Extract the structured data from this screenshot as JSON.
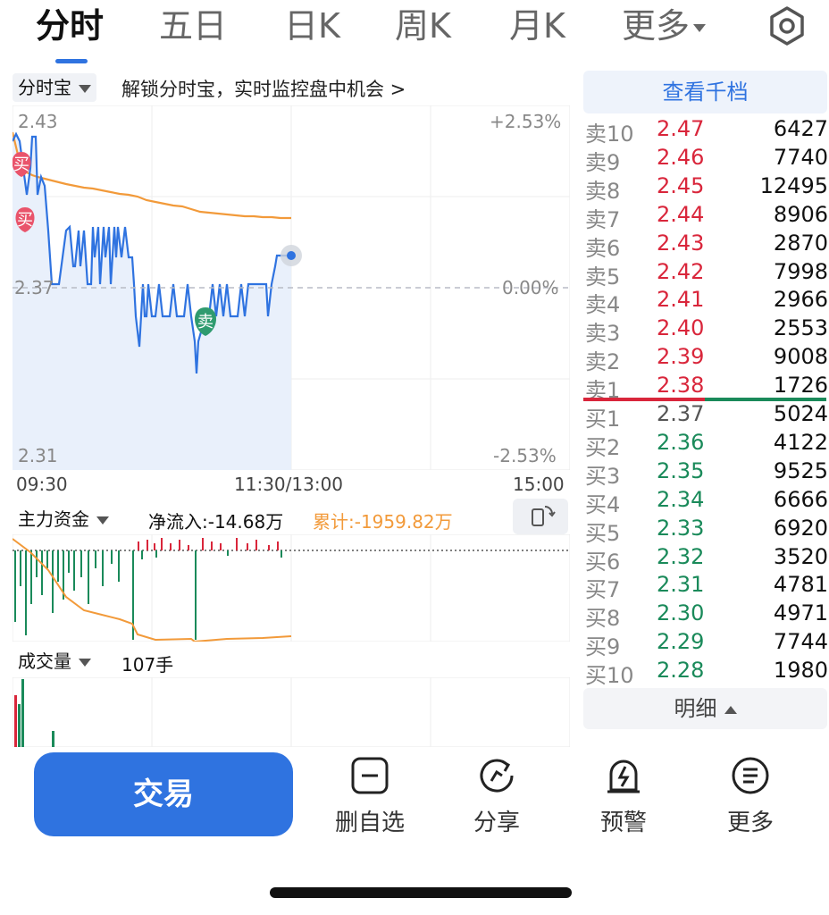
{
  "tabs": [
    "分时",
    "五日",
    "日K",
    "周K",
    "月K",
    "更多"
  ],
  "active_tab": "分时",
  "chart": {
    "indicator_dropdown": "分时宝",
    "promo_text": "解锁分时宝，实时监控盘中机会 >",
    "price_high": "2.43",
    "price_mid": "2.37",
    "price_low": "2.31",
    "pct_high": "+2.53%",
    "pct_mid": "0.00%",
    "pct_low": "-2.53%",
    "time_start": "09:30",
    "time_mid": "11:30/13:00",
    "time_end": "15:00",
    "buy_marker": "买",
    "sell_marker": "卖"
  },
  "fund_flow": {
    "dropdown": "主力资金",
    "net_inflow": "净流入:-14.68万",
    "cumulative": "累计:-1959.82万"
  },
  "volume": {
    "dropdown": "成交量",
    "value": "107手"
  },
  "order_book": {
    "button": "查看千档",
    "asks": [
      {
        "name": "卖10",
        "price": "2.47",
        "vol": "6427"
      },
      {
        "name": "卖9",
        "price": "2.46",
        "vol": "7740"
      },
      {
        "name": "卖8",
        "price": "2.45",
        "vol": "12495"
      },
      {
        "name": "卖7",
        "price": "2.44",
        "vol": "8906"
      },
      {
        "name": "卖6",
        "price": "2.43",
        "vol": "2870"
      },
      {
        "name": "卖5",
        "price": "2.42",
        "vol": "7998"
      },
      {
        "name": "卖4",
        "price": "2.41",
        "vol": "2966"
      },
      {
        "name": "卖3",
        "price": "2.40",
        "vol": "2553"
      },
      {
        "name": "卖2",
        "price": "2.39",
        "vol": "9008"
      },
      {
        "name": "卖1",
        "price": "2.38",
        "vol": "1726"
      }
    ],
    "bids": [
      {
        "name": "买1",
        "price": "2.37",
        "vol": "5024"
      },
      {
        "name": "买2",
        "price": "2.36",
        "vol": "4122"
      },
      {
        "name": "买3",
        "price": "2.35",
        "vol": "9525"
      },
      {
        "name": "买4",
        "price": "2.34",
        "vol": "6666"
      },
      {
        "name": "买5",
        "price": "2.33",
        "vol": "6920"
      },
      {
        "name": "买6",
        "price": "2.32",
        "vol": "3520"
      },
      {
        "name": "买7",
        "price": "2.31",
        "vol": "4781"
      },
      {
        "name": "买8",
        "price": "2.30",
        "vol": "4971"
      },
      {
        "name": "买9",
        "price": "2.29",
        "vol": "7744"
      },
      {
        "name": "买10",
        "price": "2.28",
        "vol": "1980"
      }
    ],
    "detail_button": "明细"
  },
  "bottom_bar": {
    "trade": "交易",
    "remove_watchlist": "删自选",
    "share": "分享",
    "alert": "预警",
    "more": "更多"
  },
  "colors": {
    "accent": "#2f73e0",
    "up_red": "#d9263b",
    "down_green": "#1a8a5a",
    "avg_line": "#f29a3a"
  },
  "icons": [
    "settings-icon",
    "remove-watchlist-icon",
    "share-icon",
    "alert-icon",
    "more-icon",
    "rotate-icon"
  ]
}
